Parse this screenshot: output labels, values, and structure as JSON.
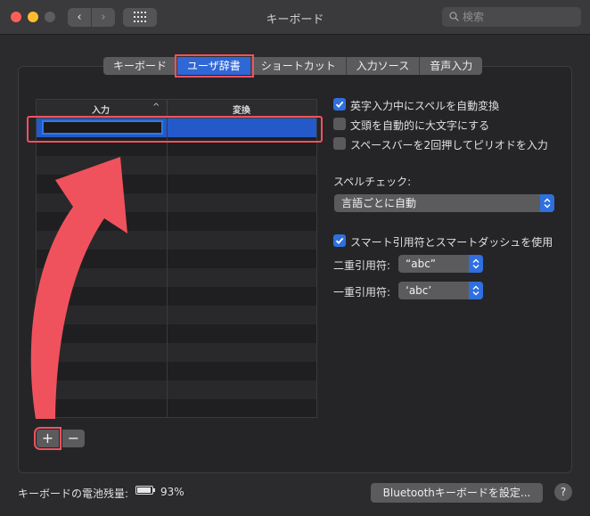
{
  "window": {
    "title": "キーボード"
  },
  "toolbar": {
    "back": "‹",
    "forward": "›"
  },
  "search": {
    "placeholder": "検索"
  },
  "tabs": [
    {
      "label": "キーボード",
      "active": false
    },
    {
      "label": "ユーザ辞書",
      "active": true
    },
    {
      "label": "ショートカット",
      "active": false
    },
    {
      "label": "入力ソース",
      "active": false
    },
    {
      "label": "音声入力",
      "active": false
    }
  ],
  "table": {
    "columns": [
      "入力",
      "変換"
    ],
    "sort_indicator": "^",
    "rows": [
      {
        "input": "",
        "conversion": ""
      }
    ]
  },
  "list_controls": {
    "add": "+",
    "remove": "−"
  },
  "options": {
    "autocorrect": {
      "label": "英字入力中にスペルを自動変換",
      "checked": true
    },
    "autocapitalize": {
      "label": "文頭を自動的に大文字にする",
      "checked": false
    },
    "double_space_period": {
      "label": "スペースバーを2回押してピリオドを入力",
      "checked": false
    },
    "spell_check_label": "スペルチェック:",
    "spell_check_value": "言語ごとに自動",
    "smart_quotes": {
      "label": "スマート引用符とスマートダッシュを使用",
      "checked": true
    },
    "double_quote_label": "二重引用符:",
    "double_quote_value": "“abc”",
    "single_quote_label": "一重引用符:",
    "single_quote_value": "‘abc’"
  },
  "footer": {
    "battery_label": "キーボードの電池残量:",
    "battery_percent": "93%",
    "battery_level": 0.93,
    "bluetooth_button": "Bluetoothキーボードを設定...",
    "help": "?"
  },
  "colors": {
    "accent": "#2f6fe0",
    "highlight": "#f0525d",
    "selection": "#2459c9"
  }
}
